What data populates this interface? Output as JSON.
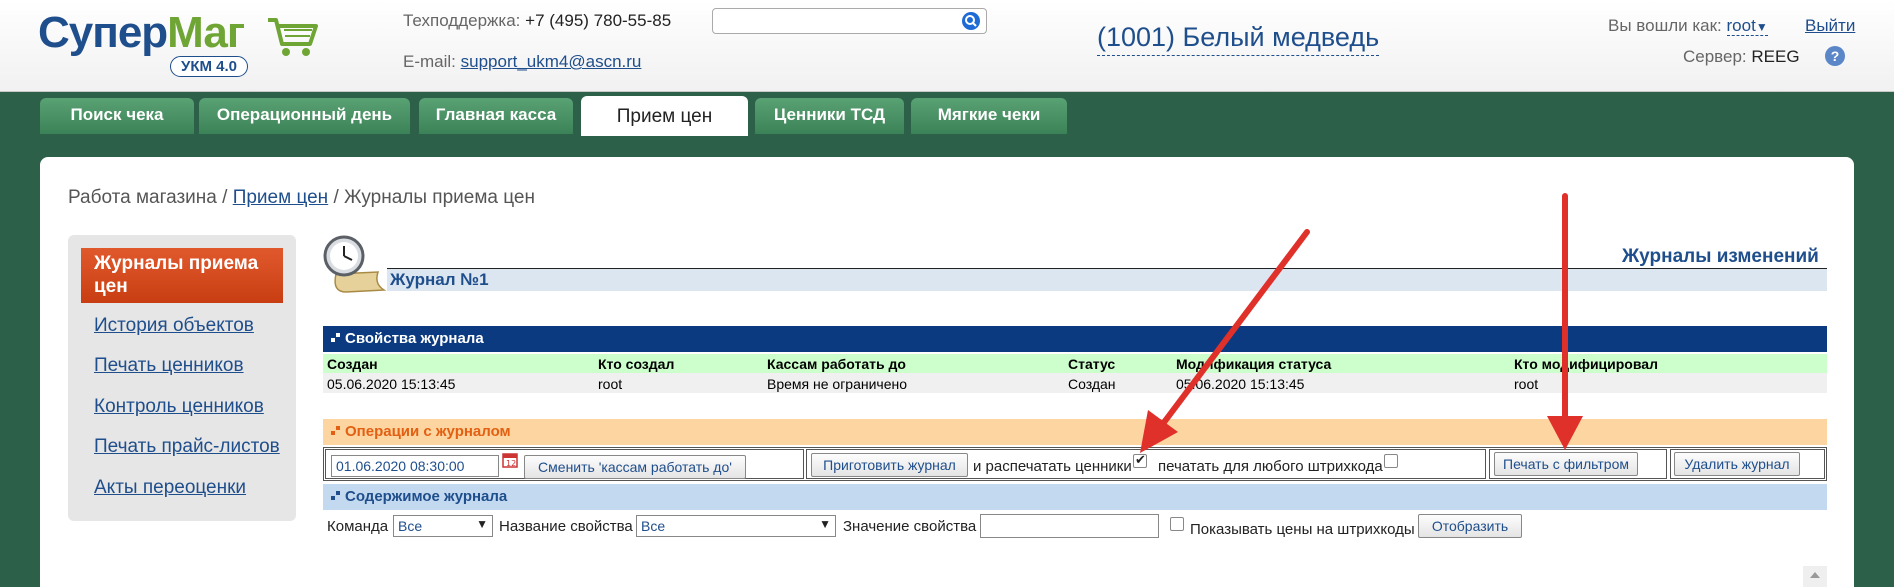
{
  "header": {
    "logo_main": "Супер",
    "logo_accent": "Маг",
    "logo_badge": "УКМ 4.0",
    "support_label": "Техподдержка:",
    "support_phone": "+7 (495) 780-55-85",
    "email_label": "E-mail:",
    "email": "support_ukm4@ascn.ru",
    "search_value": "",
    "store": "(1001) Белый медведь",
    "logged_as_label": "Вы вошли как:",
    "user": "root",
    "logout": "Выйти",
    "server_label": "Сервер:",
    "server": "REEG",
    "help": "?"
  },
  "tabs": [
    {
      "label": "Поиск чека"
    },
    {
      "label": "Операционный день"
    },
    {
      "label": "Главная касса"
    },
    {
      "label": "Прием цен",
      "active": true
    },
    {
      "label": "Ценники ТСД"
    },
    {
      "label": "Мягкие чеки"
    }
  ],
  "breadcrumb": {
    "root": "Работа магазина",
    "sep": "/",
    "link": "Прием цен",
    "current": "Журналы приема цен"
  },
  "sidebar": {
    "items": [
      {
        "label": "Журналы приема цен",
        "active": true
      },
      {
        "label": "История объектов"
      },
      {
        "label": "Печать ценников"
      },
      {
        "label": "Контроль ценников"
      },
      {
        "label": "Печать прайс-листов"
      },
      {
        "label": "Акты переоценки"
      }
    ]
  },
  "journal": {
    "title": "Журнал №1",
    "changes_link": "Журналы изменений"
  },
  "properties": {
    "title": "Свойства журнала",
    "columns": [
      "Создан",
      "Кто создал",
      "Кассам работать до",
      "Статус",
      "Модификация статуса",
      "Кто модифицировал"
    ],
    "row": [
      "05.06.2020 15:13:45",
      "root",
      "Время не ограничено",
      "Создан",
      "05.06.2020 15:13:45",
      "root"
    ]
  },
  "operations": {
    "title": "Операции с журналом",
    "date_value": "01.06.2020 08:30:00",
    "change_button": "Сменить 'кассам работать до'",
    "prepare_button": "Приготовить журнал",
    "print_tags_label": "и распечатать ценники",
    "print_tags_checked": true,
    "any_barcode_label": "печатать для любого штрихкода",
    "any_barcode_checked": false,
    "print_filter_button": "Печать с фильтром",
    "delete_button": "Удалить журнал"
  },
  "contents": {
    "title": "Содержимое журнала",
    "command_label": "Команда",
    "command_value": "Все",
    "prop_name_label": "Название свойства",
    "prop_name_value": "Все",
    "prop_value_label": "Значение свойства",
    "prop_value": "",
    "show_prices_label": "Показывать цены на штрихкоды",
    "show_prices_checked": false,
    "show_button": "Отобразить"
  },
  "colors": {
    "background": "#2d6049",
    "brand_blue": "#1f4e8c",
    "active_orange": "#d14a1c",
    "annotation_red": "#e0302a"
  }
}
